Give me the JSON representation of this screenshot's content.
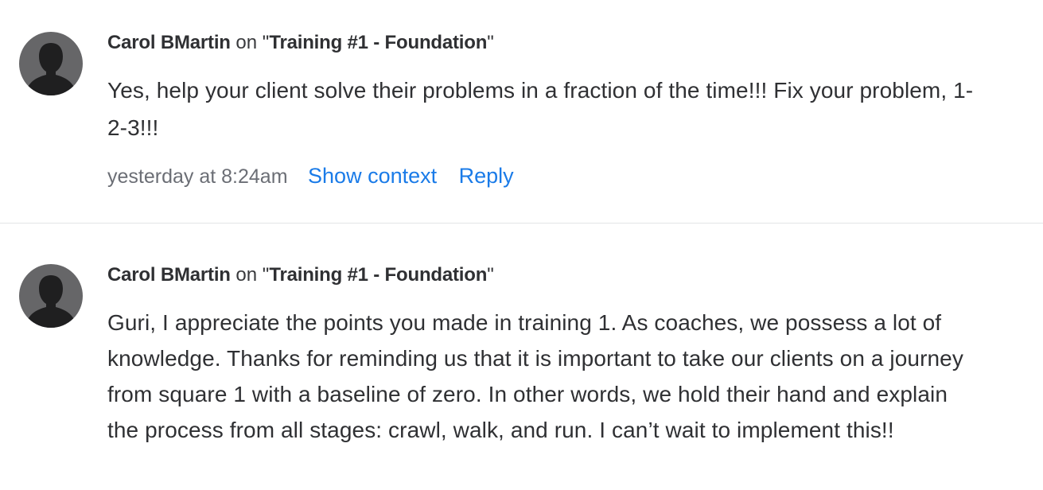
{
  "comments": [
    {
      "author": "Carol BMartin",
      "on_word": "on",
      "course": "Training #1 - Foundation",
      "avatar_icon": "default-user-silhouette-icon",
      "text": "Yes, help your client solve their problems in a fraction of the time!!! Fix your problem, 1-2-3!!!",
      "timestamp": "yesterday at 8:24am",
      "show_context_label": "Show context",
      "reply_label": "Reply"
    },
    {
      "author": "Carol BMartin",
      "on_word": "on",
      "course": "Training #1 - Foundation",
      "avatar_icon": "default-user-silhouette-icon",
      "text": "Guri, I appreciate the points you made in training 1. As coaches, we possess a lot of knowledge. Thanks for reminding us that it is important to take our clients on a journey from square 1 with a baseline of zero. In other words, we hold their hand and explain the process from all stages: crawl, walk, and run. I can’t wait to implement this!!"
    }
  ],
  "colors": {
    "link": "#1a7be8",
    "text": "#2f3033",
    "muted": "#6b6e75",
    "avatar_bg": "#666668",
    "divider": "#e3e4e6"
  }
}
